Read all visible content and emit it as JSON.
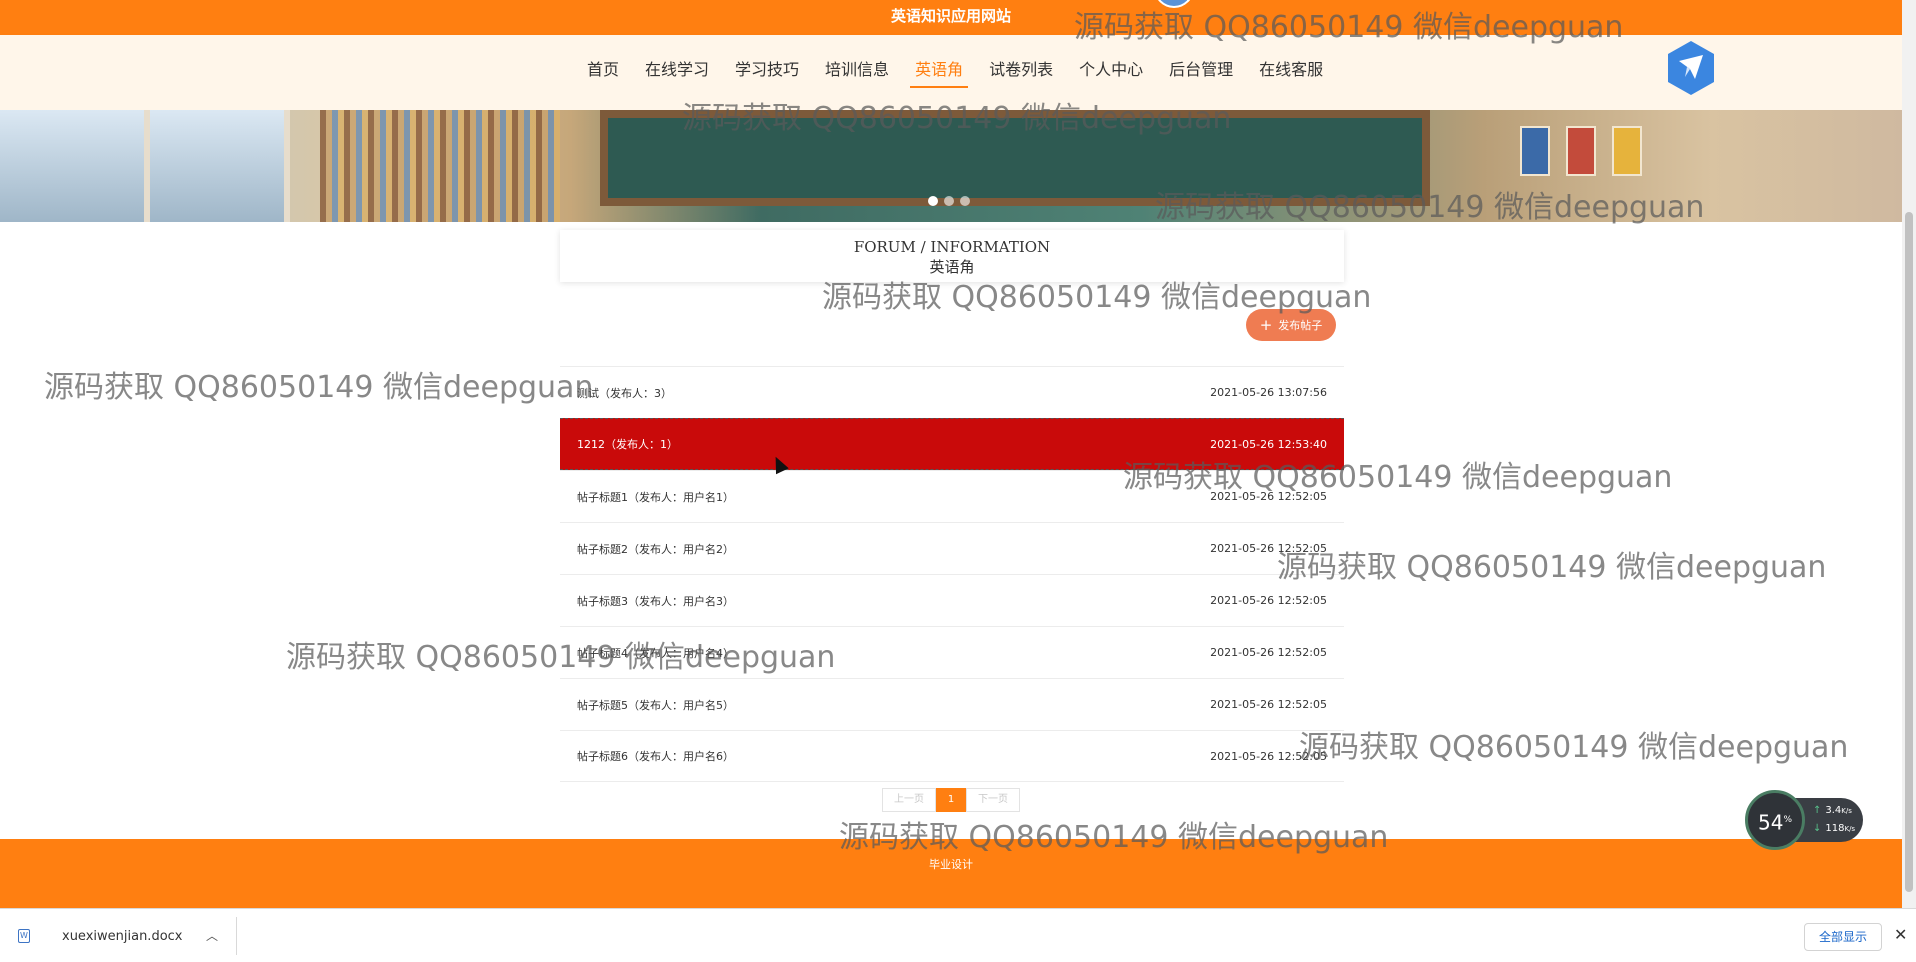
{
  "header": {
    "site_title": "英语知识应用网站"
  },
  "nav": {
    "items": [
      {
        "label": "首页",
        "active": false
      },
      {
        "label": "在线学习",
        "active": false
      },
      {
        "label": "学习技巧",
        "active": false
      },
      {
        "label": "培训信息",
        "active": false
      },
      {
        "label": "英语角",
        "active": true
      },
      {
        "label": "试卷列表",
        "active": false
      },
      {
        "label": "个人中心",
        "active": false
      },
      {
        "label": "后台管理",
        "active": false
      },
      {
        "label": "在线客服",
        "active": false
      }
    ],
    "accent_color": "#ff7f11"
  },
  "banner": {
    "slides": 3,
    "active_slide": 1
  },
  "section": {
    "title_en": "FORUM / INFORMATION",
    "title_zh": "英语角"
  },
  "actions": {
    "publish_label": "发布帖子",
    "publish_icon": "plus-icon"
  },
  "posts": [
    {
      "title": "测试（发布人：3）",
      "time": "2021-05-26 13:07:56",
      "highlighted": false
    },
    {
      "title": "1212（发布人：1）",
      "time": "2021-05-26 12:53:40",
      "highlighted": true
    },
    {
      "title": "帖子标题1（发布人：用户名1）",
      "time": "2021-05-26 12:52:05",
      "highlighted": false
    },
    {
      "title": "帖子标题2（发布人：用户名2）",
      "time": "2021-05-26 12:52:05",
      "highlighted": false
    },
    {
      "title": "帖子标题3（发布人：用户名3）",
      "time": "2021-05-26 12:52:05",
      "highlighted": false
    },
    {
      "title": "帖子标题4（发布人：用户名4）",
      "time": "2021-05-26 12:52:05",
      "highlighted": false
    },
    {
      "title": "帖子标题5（发布人：用户名5）",
      "time": "2021-05-26 12:52:05",
      "highlighted": false
    },
    {
      "title": "帖子标题6（发布人：用户名6）",
      "time": "2021-05-26 12:52:05",
      "highlighted": false
    }
  ],
  "pagination": {
    "prev": "上一页",
    "current": "1",
    "next": "下一页"
  },
  "footer": {
    "text": "毕业设计"
  },
  "speed_widget": {
    "percent": "54",
    "percent_unit": "%",
    "up": "3.4",
    "up_unit": "K/s",
    "down": "118",
    "down_unit": "K/s"
  },
  "downloads": {
    "file_name": "xuexiwenjian.docx",
    "show_all": "全部显示"
  },
  "watermark": {
    "text": "源码获取 QQ86050149 微信deepguan"
  }
}
